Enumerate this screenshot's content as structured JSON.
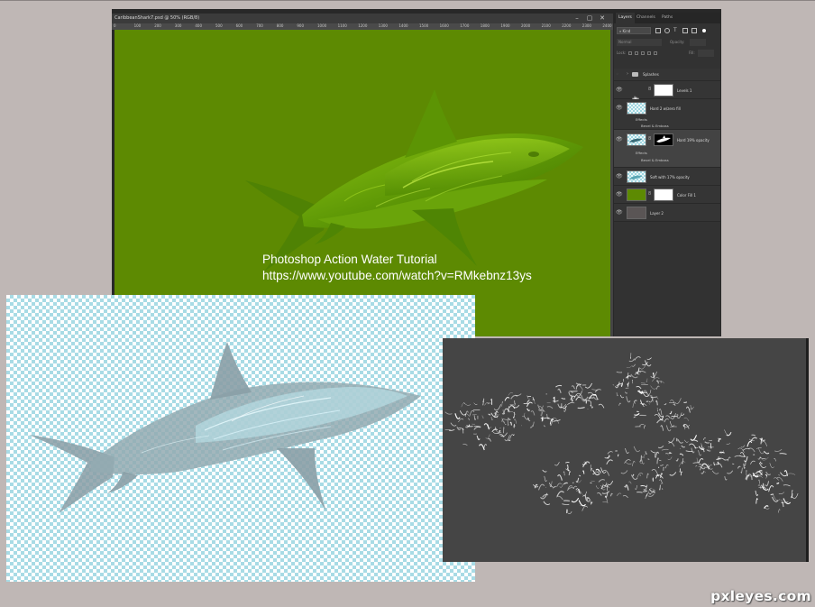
{
  "document": {
    "title": "CaribbeanShark7.psd @ 50% (RGB/8)",
    "ruler_ticks": [
      "0",
      "100",
      "200",
      "300",
      "400",
      "500",
      "600",
      "700",
      "800",
      "900",
      "1000",
      "1100",
      "1200",
      "1300",
      "1400",
      "1500",
      "1600",
      "1700",
      "1800",
      "1900",
      "2000",
      "2100",
      "2200",
      "2300",
      "2400"
    ]
  },
  "window": {
    "minimize_label": "–",
    "restore_label": "▢",
    "close_label": "✕"
  },
  "panel": {
    "tabs": [
      {
        "label": "Layers",
        "active": true
      },
      {
        "label": "Channels",
        "active": false
      },
      {
        "label": "Paths",
        "active": false
      }
    ],
    "filter_kind": "Kind",
    "blend_mode": "Normal",
    "opacity_label": "Opacity:",
    "lock_label": "Lock:",
    "fill_label": "Fill:"
  },
  "layers": [
    {
      "name": "Splashes",
      "type": "group"
    },
    {
      "name": "Levels 1",
      "type": "adjustment"
    },
    {
      "name": "Hard 2 w/zero fill",
      "type": "pixel",
      "sub": [
        "Effects",
        "Bevel & Emboss"
      ]
    },
    {
      "name": "Hard 19% opacity",
      "type": "masked",
      "selected": true,
      "sub": [
        "Effects",
        "Bevel & Emboss"
      ]
    },
    {
      "name": "Soft with 17% opacity",
      "type": "pixel"
    },
    {
      "name": "Color Fill 1",
      "type": "fill"
    },
    {
      "name": "Layer 2",
      "type": "pixel"
    }
  ],
  "overlay_text": {
    "line1": "Photoshop Action Water Tutorial",
    "line2": "https://www.youtube.com/watch?v=RMkebnz13ys"
  },
  "watermark": "pxleyes.com",
  "colors": {
    "canvas_green": "#5d8a02",
    "splash_bg": "#454545",
    "checker_blue": "#a8dbe5",
    "page_bg": "#bfb7b5"
  }
}
